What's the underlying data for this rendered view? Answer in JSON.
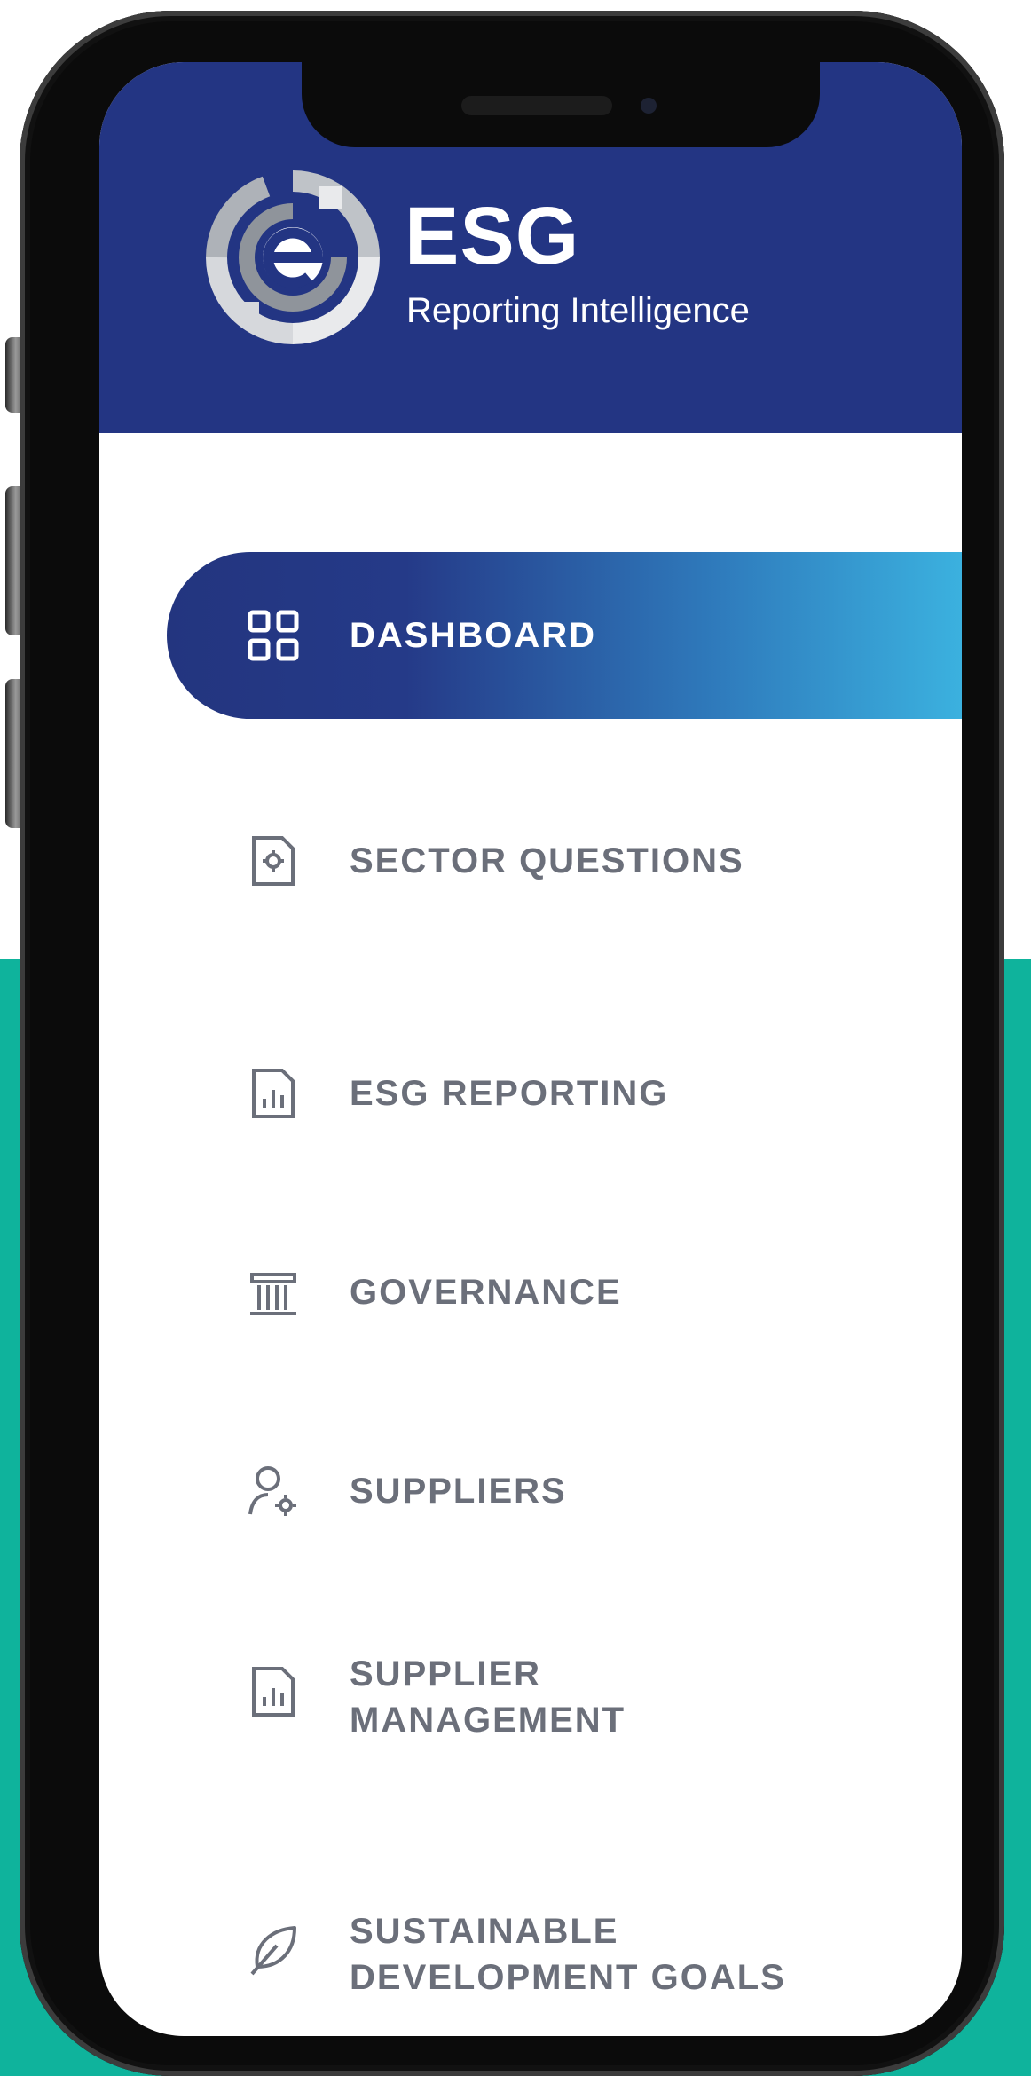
{
  "brand": {
    "title": "ESG",
    "subtitle": "Reporting Intelligence"
  },
  "colors": {
    "header": "#233583",
    "active_start": "#23357f",
    "active_end": "#3bb1df",
    "menu_text": "#6b6f7a",
    "teal_background": "#0fb39c"
  },
  "menu": {
    "items": [
      {
        "label": "DASHBOARD",
        "icon": "grid-icon",
        "active": true
      },
      {
        "label": "SECTOR QUESTIONS",
        "icon": "document-gear-icon",
        "active": false
      },
      {
        "label": "ESG REPORTING",
        "icon": "report-chart-icon",
        "active": false
      },
      {
        "label": "GOVERNANCE",
        "icon": "building-icon",
        "active": false
      },
      {
        "label": "SUPPLIERS",
        "icon": "user-gear-icon",
        "active": false
      },
      {
        "label_line1": "SUPPLIER",
        "label_line2": "MANAGEMENT",
        "icon": "report-chart-icon",
        "active": false
      },
      {
        "label_line1": "SUSTAINABLE",
        "label_line2": "DEVELOPMENT GOALS",
        "icon": "leaf-icon",
        "active": false
      }
    ]
  }
}
